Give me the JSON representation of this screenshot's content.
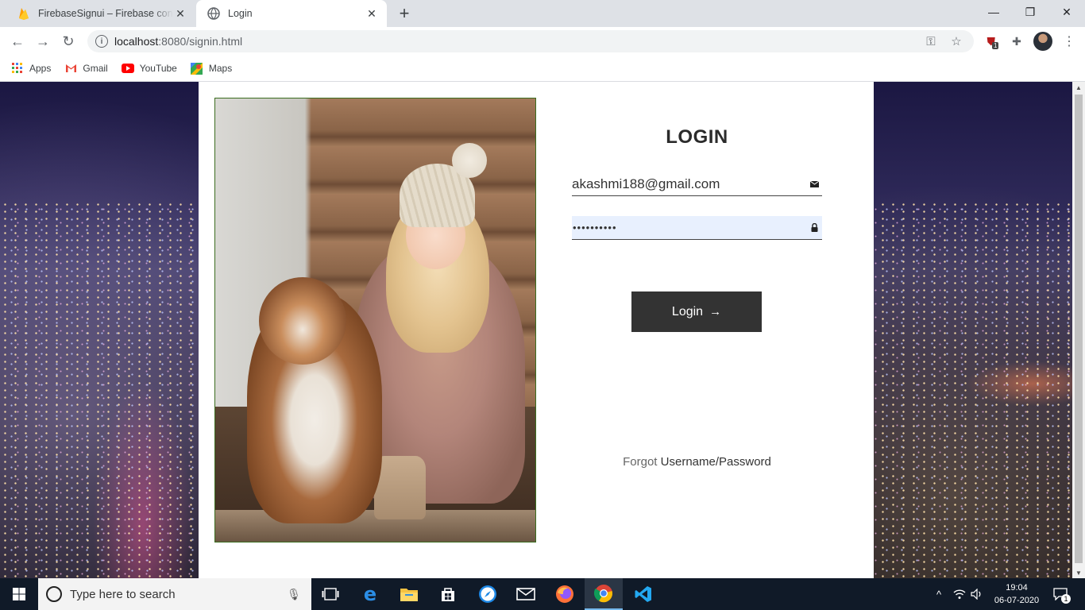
{
  "browser": {
    "tabs": [
      {
        "title": "FirebaseSignui – Firebase console",
        "active": false
      },
      {
        "title": "Login",
        "active": true
      }
    ],
    "address": {
      "host": "localhost",
      "path": ":8080/signin.html"
    },
    "bookmarks": [
      {
        "label": "Apps",
        "icon": "apps-grid-icon"
      },
      {
        "label": "Gmail",
        "icon": "gmail-icon"
      },
      {
        "label": "YouTube",
        "icon": "youtube-icon"
      },
      {
        "label": "Maps",
        "icon": "maps-icon"
      }
    ],
    "extension_badge": "1"
  },
  "page": {
    "title": "LOGIN",
    "email": {
      "value": "akashmi188@gmail.com"
    },
    "password": {
      "value": "••••••••••"
    },
    "login_button": "Login",
    "forgot": {
      "part1": "Forgot",
      "part2": "Username/Password"
    }
  },
  "taskbar": {
    "search_placeholder": "Type here to search",
    "time": "19:04",
    "date": "06-07-2020",
    "notifications": "1"
  },
  "colors": {
    "button_bg": "#333333",
    "autofill_bg": "#e8f0fe",
    "taskbar_bg": "#101a28"
  }
}
